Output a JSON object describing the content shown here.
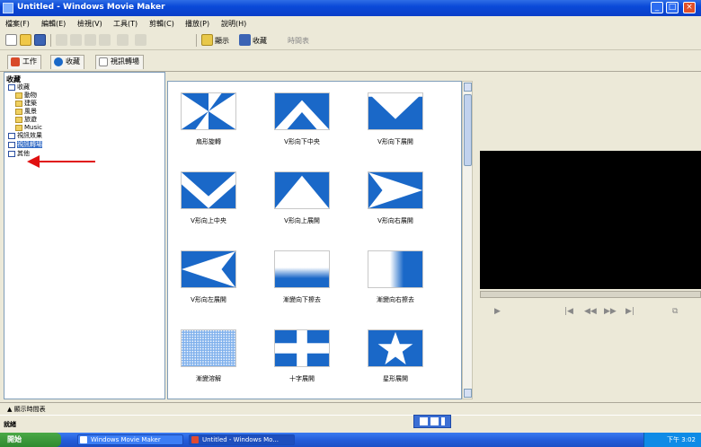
{
  "window": {
    "title": "Untitled - Windows Movie Maker",
    "minimize": "_",
    "maximize": "□",
    "close": "×"
  },
  "menu": [
    "檔案(F)",
    "編輯(E)",
    "檢視(V)",
    "工具(T)",
    "剪輯(C)",
    "播放(P)",
    "說明(H)"
  ],
  "toolbar": {
    "show_collections": "顯示",
    "collections_label": "收藏",
    "timeline_label": "時間表"
  },
  "tabs": [
    {
      "label": "工作",
      "icon": "task-icon"
    },
    {
      "label": "收藏",
      "icon": "collections-icon"
    },
    {
      "label": "視訊轉場",
      "icon": "transition-icon"
    }
  ],
  "collections": {
    "header": "收藏",
    "items": [
      {
        "label": "收藏",
        "level": 0,
        "icon": "collection-root-icon"
      },
      {
        "label": "動物",
        "level": 1,
        "icon": "folder-icon"
      },
      {
        "label": "建築",
        "level": 1,
        "icon": "folder-icon"
      },
      {
        "label": "風景",
        "level": 1,
        "icon": "folder-icon"
      },
      {
        "label": "旅遊",
        "level": 1,
        "icon": "folder-icon"
      },
      {
        "label": "Music",
        "level": 1,
        "icon": "folder-icon"
      },
      {
        "label": "視訊效果",
        "level": 0,
        "icon": "video-effects-icon"
      },
      {
        "label": "視訊轉場",
        "level": 0,
        "icon": "video-transitions-icon",
        "selected": true
      },
      {
        "label": "其他",
        "level": 0,
        "icon": "other-icon"
      }
    ]
  },
  "transitions": [
    {
      "label": "扇形旋轉",
      "pattern": "pinwheel"
    },
    {
      "label": "V形向下中央",
      "pattern": "chevron-up"
    },
    {
      "label": "V形向下展開",
      "pattern": "chevron-down"
    },
    {
      "label": "V形向上中央",
      "pattern": "chevron-down-wide"
    },
    {
      "label": "V形向上展開",
      "pattern": "chevron-up-wide"
    },
    {
      "label": "V形向右展開",
      "pattern": "chevron-right"
    },
    {
      "label": "V形向左展開",
      "pattern": "chevron-left"
    },
    {
      "label": "漸變向下擦去",
      "pattern": "fade-down"
    },
    {
      "label": "漸變向右擦去",
      "pattern": "fade-right"
    },
    {
      "label": "漸變溶解",
      "pattern": "dissolve"
    },
    {
      "label": "十字展開",
      "pattern": "cross"
    },
    {
      "label": "星形展開",
      "pattern": "star"
    }
  ],
  "player": {
    "play": "▶",
    "prev": "|◀",
    "rewind": "◀◀",
    "forward": "▶▶",
    "next": "▶|",
    "split": "⧉"
  },
  "storyboard": {
    "toggle_label": "▲ 顯示時間表"
  },
  "status": {
    "text": "就緒"
  },
  "taskbar": {
    "start": "開始",
    "tasks": [
      {
        "label": "Windows Movie Maker",
        "active": false
      },
      {
        "label": "Untitled - Windows Mo...",
        "active": true
      }
    ],
    "clock": "下午 3:02"
  },
  "colors": {
    "accent": "#1a68c8",
    "title_bar": "#0a49d8",
    "arrow": "#e01010"
  }
}
